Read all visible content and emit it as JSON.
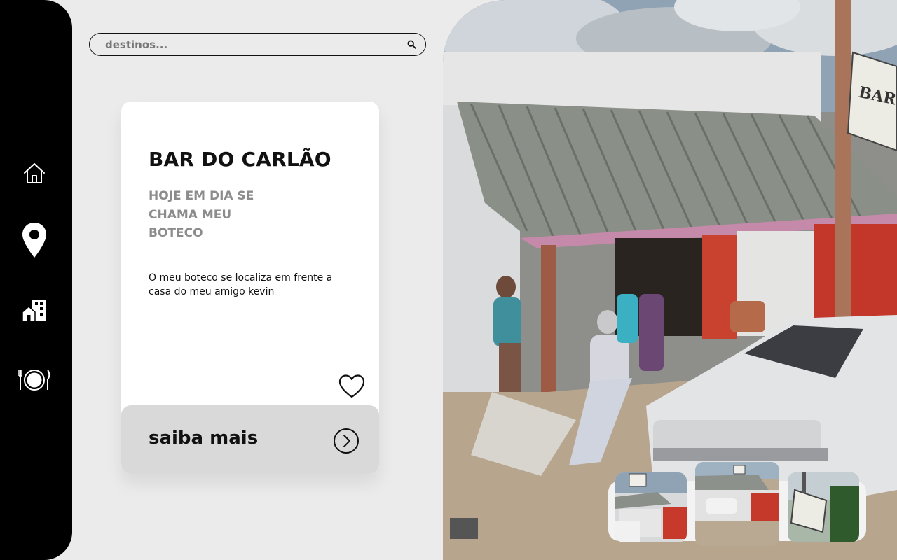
{
  "search": {
    "placeholder": "destinos..."
  },
  "sidebar": {
    "items": [
      {
        "icon": "home-icon"
      },
      {
        "icon": "map-pin-icon"
      },
      {
        "icon": "city-icon"
      },
      {
        "icon": "restaurant-icon"
      }
    ]
  },
  "card": {
    "title": "BAR DO CARLÃO",
    "subtitle": "HOJE EM DIA SE CHAMA MEU BOTECO",
    "description": "O meu boteco se localiza em frente a casa do meu amigo kevin",
    "cta_label": "saiba mais"
  },
  "photo": {
    "sign_text": "BAR DO CARLÃO"
  },
  "colors": {
    "sidebar": "#000000",
    "background": "#ebebeb",
    "card": "#ffffff",
    "card_footer": "#d9d9d9",
    "subtitle": "#8c8c8c"
  }
}
